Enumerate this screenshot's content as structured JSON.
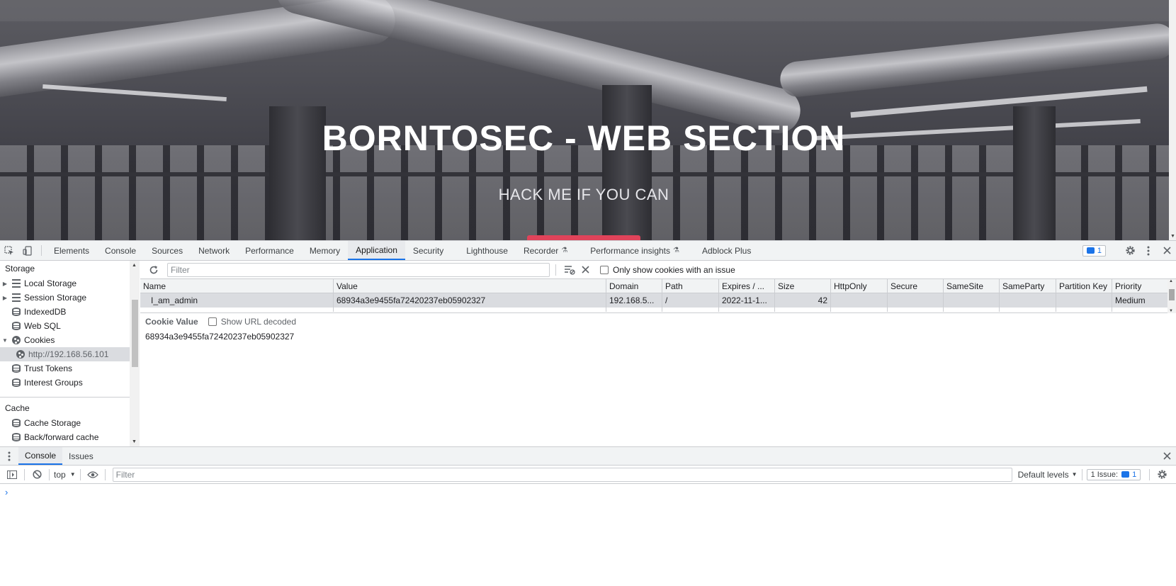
{
  "webpage": {
    "title": "BORNTOSEC - WEB SECTION",
    "subtitle": "HACK ME IF YOU CAN"
  },
  "devtools": {
    "tabs": [
      {
        "label": "Elements"
      },
      {
        "label": "Console"
      },
      {
        "label": "Sources"
      },
      {
        "label": "Network"
      },
      {
        "label": "Performance"
      },
      {
        "label": "Memory"
      },
      {
        "label": "Application",
        "active": true
      },
      {
        "label": "Security"
      },
      {
        "label": "Lighthouse"
      },
      {
        "label": "Recorder"
      },
      {
        "label": "Performance insights"
      },
      {
        "label": "Adblock Plus"
      }
    ],
    "issues_count": "1"
  },
  "sidebar": {
    "storage_title": "Storage",
    "storage_items": [
      {
        "label": "Local Storage",
        "icon": "grid-icon",
        "expandable": "collapsed"
      },
      {
        "label": "Session Storage",
        "icon": "grid-icon",
        "expandable": "collapsed"
      },
      {
        "label": "IndexedDB",
        "icon": "database-icon"
      },
      {
        "label": "Web SQL",
        "icon": "database-icon"
      },
      {
        "label": "Cookies",
        "icon": "cookie-icon",
        "expandable": "expanded"
      },
      {
        "label": "http://192.168.56.101",
        "icon": "cookie-icon",
        "selected": true
      },
      {
        "label": "Trust Tokens",
        "icon": "database-icon"
      },
      {
        "label": "Interest Groups",
        "icon": "database-icon"
      }
    ],
    "cache_title": "Cache",
    "cache_items": [
      {
        "label": "Cache Storage",
        "icon": "database-icon"
      },
      {
        "label": "Back/forward cache",
        "icon": "database-icon"
      }
    ]
  },
  "cookies": {
    "filter_placeholder": "Filter",
    "only_issues_label": "Only show cookies with an issue",
    "columns": [
      "Name",
      "Value",
      "Domain",
      "Path",
      "Expires / ...",
      "Size",
      "HttpOnly",
      "Secure",
      "SameSite",
      "SameParty",
      "Partition Key",
      "Priority"
    ],
    "rows": [
      {
        "name": "I_am_admin",
        "value": "68934a3e9455fa72420237eb05902327",
        "domain": "192.168.5...",
        "path": "/",
        "expires": "2022-11-1...",
        "size": "42",
        "httponly": "",
        "secure": "",
        "samesite": "",
        "sameparty": "",
        "partition_key": "",
        "priority": "Medium"
      }
    ],
    "cookie_value_title": "Cookie Value",
    "show_url_decoded_label": "Show URL decoded",
    "cookie_value": "68934a3e9455fa72420237eb05902327"
  },
  "drawer": {
    "tabs": [
      {
        "label": "Console",
        "active": true
      },
      {
        "label": "Issues"
      }
    ],
    "context": "top",
    "filter_placeholder": "Filter",
    "levels": "Default levels",
    "issues_label": "1 Issue:",
    "issues_count": "1"
  },
  "colors": {
    "accent": "#1a73e8",
    "hero_button": "#e0435a"
  }
}
